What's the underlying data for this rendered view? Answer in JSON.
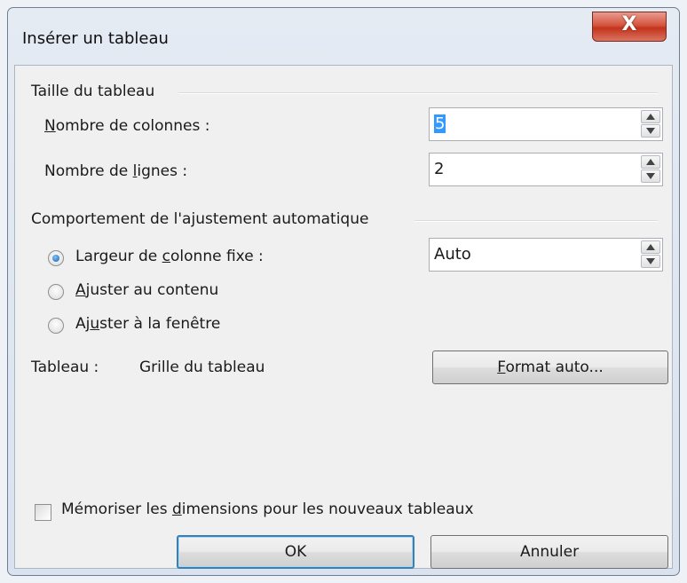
{
  "window": {
    "title": "Insérer un tableau",
    "close_label": "X"
  },
  "size_group": {
    "label": "Taille du tableau",
    "columns": {
      "label_pre": "",
      "label_mnemonic": "N",
      "label_post": "ombre de colonnes :",
      "value": "5"
    },
    "rows": {
      "label_pre": "Nombre de ",
      "label_mnemonic": "l",
      "label_post": "ignes :",
      "value": "2"
    }
  },
  "autofit_group": {
    "label": "Comportement de l'ajustement automatique",
    "fixed": {
      "label_pre": "Largeur de ",
      "label_mnemonic": "c",
      "label_post": "olonne fixe :",
      "selected": true,
      "value": "Auto"
    },
    "contents": {
      "label_pre": "",
      "label_mnemonic": "A",
      "label_post": "juster au contenu",
      "selected": false
    },
    "window": {
      "label_pre": "Aj",
      "label_mnemonic": "u",
      "label_post": "ster à la fenêtre",
      "selected": false
    }
  },
  "table_style": {
    "label": "Tableau :",
    "value": "Grille du tableau",
    "autoformat_pre": "",
    "autoformat_mnemonic": "F",
    "autoformat_post": "ormat auto..."
  },
  "remember": {
    "label_pre": "Mémoriser les ",
    "label_mnemonic": "d",
    "label_post": "imensions pour les nouveaux tableaux",
    "checked": false
  },
  "buttons": {
    "ok": "OK",
    "cancel": "Annuler"
  }
}
